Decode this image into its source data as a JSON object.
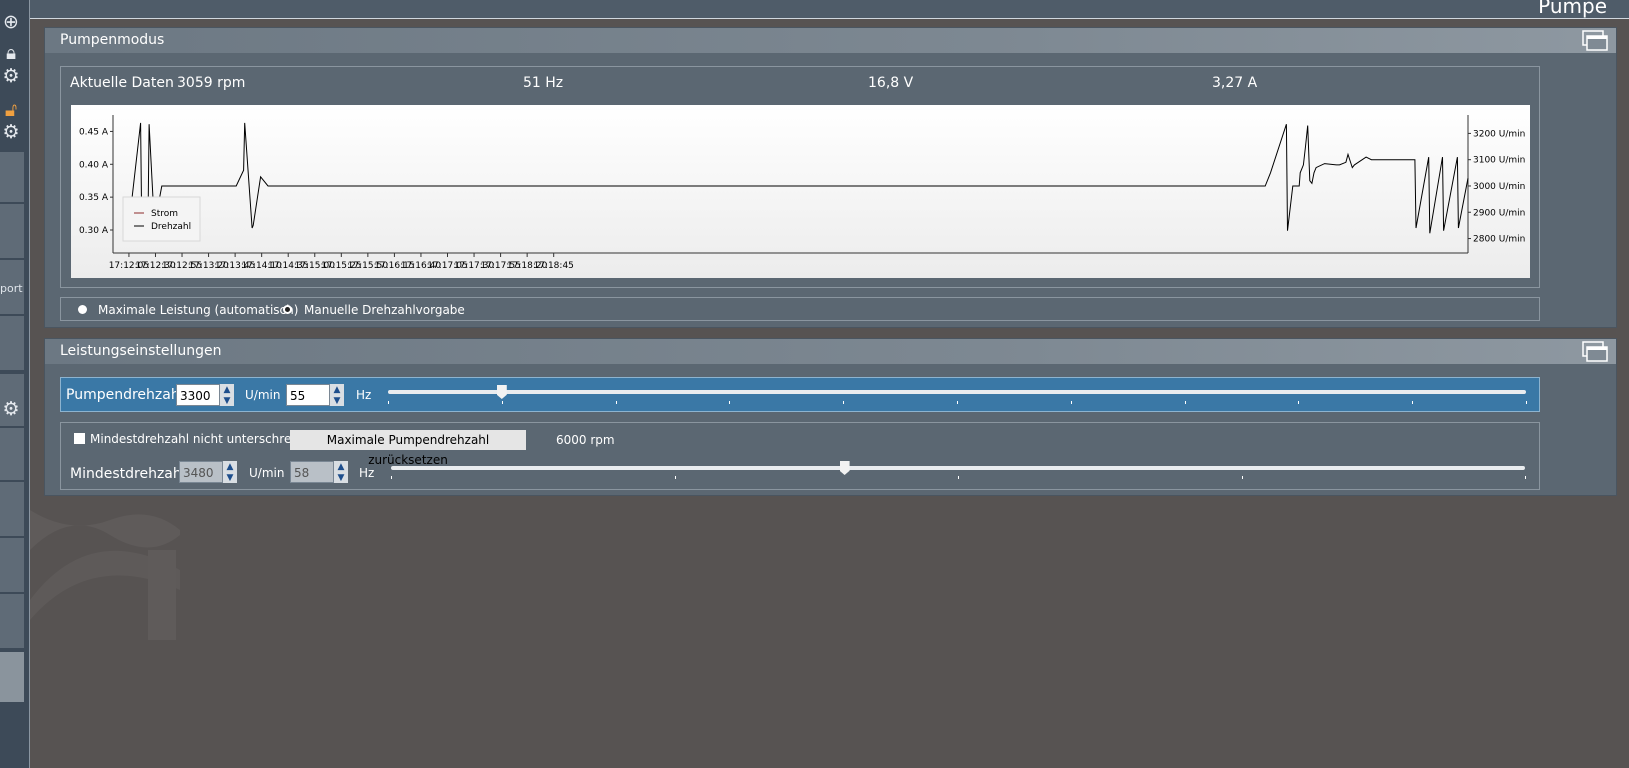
{
  "page_title": "Pumpe",
  "sidebar": {
    "partial_text": "port"
  },
  "mode_panel": {
    "title": "Pumpenmodus",
    "current_label": "Aktuelle Daten",
    "rpm": "3059 rpm",
    "hz": "51 Hz",
    "voltage": "16,8 V",
    "current": "3,27 A",
    "radio_auto": "Maximale Leistung (automatisch)",
    "radio_manual": "Manuelle Drehzahlvorgabe",
    "selected": "manual"
  },
  "chart_data": {
    "type": "line",
    "x_ticks": [
      "17:12:05",
      "17:12:30",
      "17:12:55",
      "17:13:20",
      "17:13:45",
      "17:14:10",
      "17:14:35",
      "17:15:00",
      "17:15:25",
      "17:15:50",
      "17:16:15",
      "17:16:40",
      "17:17:05",
      "17:17:30",
      "17:17:55",
      "17:18:20",
      "17:18:45"
    ],
    "left_ticks": [
      "0.45 A",
      "0.40 A",
      "0.35 A",
      "0.30 A"
    ],
    "left_values": [
      0.45,
      0.4,
      0.35,
      0.3
    ],
    "right_ticks": [
      "3200 U/min",
      "3100 U/min",
      "3000 U/min",
      "2900 U/min",
      "2800 U/min"
    ],
    "right_values": [
      3200,
      3100,
      3000,
      2900,
      2800
    ],
    "legend": [
      "Strom",
      "Drehzahl"
    ],
    "colors": {
      "strom": "#8b2a2a",
      "drehzahl": "#000000"
    },
    "series": [
      {
        "name": "Drehzahl",
        "x_seconds": [
          0,
          11,
          12,
          18,
          19,
          24,
          31,
          101,
          108,
          109,
          116,
          117,
          124,
          131,
          1070,
          1075,
          1090,
          1091,
          1096,
          1102,
          1103,
          1106,
          1108,
          1110,
          1112,
          1114,
          1116,
          1118,
          1126,
          1137,
          1140,
          1146,
          1148,
          1152,
          1154,
          1165,
          1170,
          1182,
          1204,
          1211,
          1212,
          1224,
          1225,
          1237,
          1238,
          1251,
          1252,
          1261
        ],
        "y_rpm": [
          2850,
          3240,
          2860,
          2860,
          3235,
          2850,
          3000,
          3000,
          3060,
          3240,
          2840,
          2850,
          3035,
          3000,
          3000,
          3050,
          3235,
          2830,
          3000,
          3000,
          3050,
          3080,
          3150,
          3230,
          3020,
          3010,
          3050,
          3070,
          3085,
          3080,
          3080,
          3090,
          3120,
          3070,
          3080,
          3110,
          3100,
          3100,
          3100,
          3100,
          2840,
          3110,
          2820,
          3110,
          2830,
          3110,
          2840,
          3030
        ]
      }
    ]
  },
  "power_panel": {
    "title": "Leistungseinstellungen",
    "pump_speed_label": "Pumpendrehzahl",
    "pump_rpm_value": "3300",
    "rpm_unit": "U/min",
    "pump_hz_value": "55",
    "hz_unit": "Hz",
    "pump_slider_fraction": 0.1,
    "min_checkbox_label": "Mindestdrehzahl nicht unterschreiten",
    "min_checkbox_checked": false,
    "reset_button": "Maximale Pumpendrehzahl zurücksetzen",
    "max_rpm": "6000 rpm",
    "min_speed_label": "Mindestdrehzahl",
    "min_rpm_value": "3480",
    "min_hz_value": "58",
    "min_slider_fraction": 0.4
  }
}
